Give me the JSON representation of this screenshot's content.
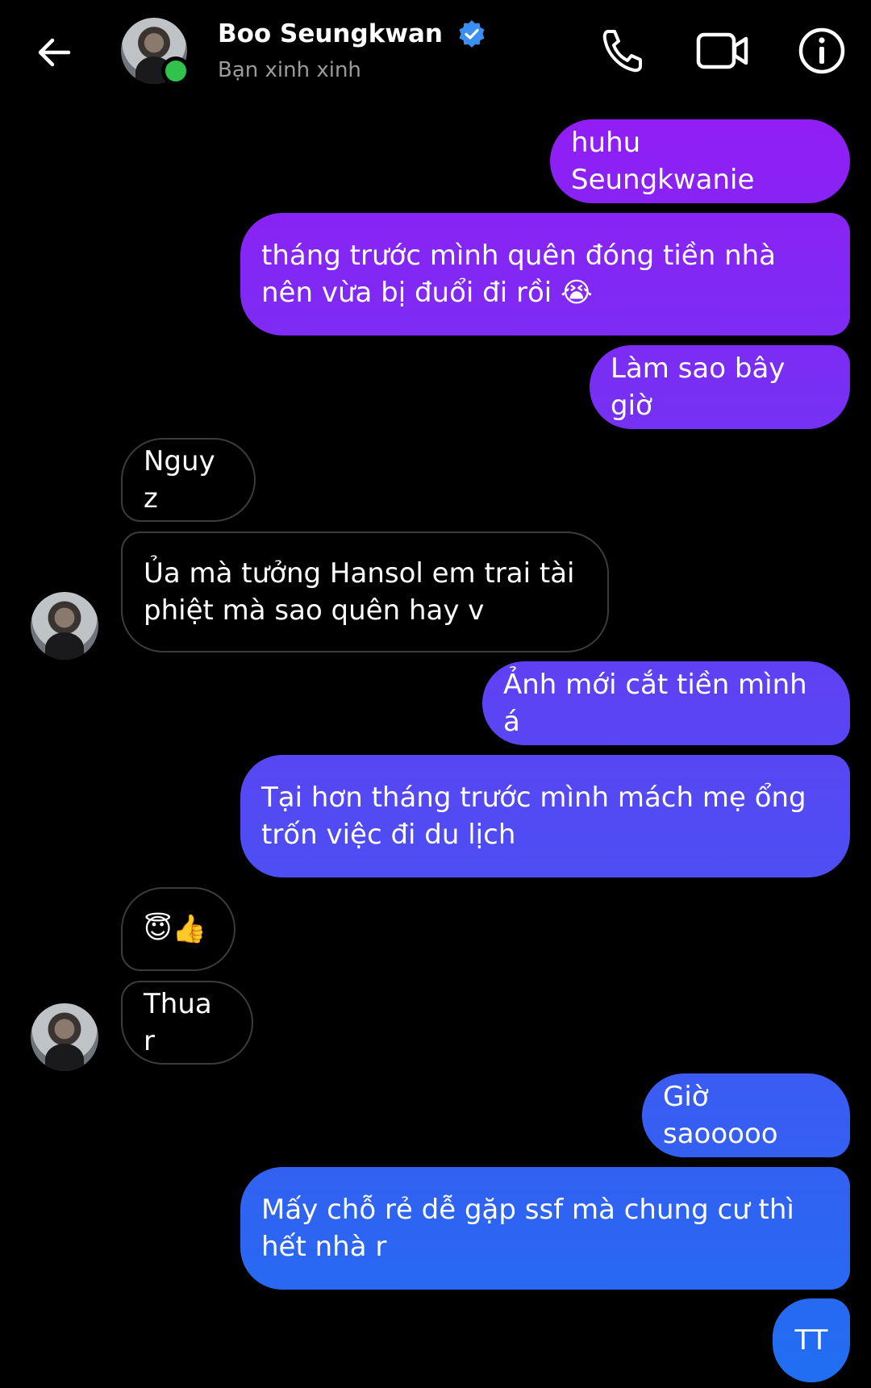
{
  "header": {
    "name": "Boo Seungkwan",
    "subtitle": "Bạn xinh xinh",
    "icons": [
      "back-arrow-icon",
      "verified-icon",
      "phone-icon",
      "video-camera-icon",
      "info-icon"
    ]
  },
  "colors": {
    "outgoing_gradient_top": "#9b16f5",
    "outgoing_gradient_bottom": "#1f6ff2",
    "incoming_border": "#3c3c3c",
    "online": "#31c24d",
    "verified": "#3b8ff0"
  },
  "messages": [
    {
      "sender": "me",
      "text": "huhu Seungkwanie"
    },
    {
      "sender": "me",
      "text": "tháng trước mình quên đóng tiền nhà\nnên vừa bị đuổi đi rồi 😭"
    },
    {
      "sender": "me",
      "text": "Làm sao bây giờ"
    },
    {
      "sender": "them",
      "text": "Nguy z"
    },
    {
      "sender": "them",
      "text": "Ủa mà tưởng Hansol em trai tài\nphiệt mà sao quên hay v"
    },
    {
      "sender": "me",
      "text": "Ảnh mới cắt tiền mình á"
    },
    {
      "sender": "me",
      "text": "Tại hơn tháng trước mình mách mẹ ổng\ntrốn việc đi du lịch"
    },
    {
      "sender": "them",
      "text": "😇👍"
    },
    {
      "sender": "them",
      "text": "Thua r"
    },
    {
      "sender": "me",
      "text": "Giờ saooooo"
    },
    {
      "sender": "me",
      "text": "Mấy chỗ rẻ dễ gặp ssf mà chung cư thì\nhết nhà r"
    },
    {
      "sender": "me",
      "text": "TT"
    }
  ]
}
